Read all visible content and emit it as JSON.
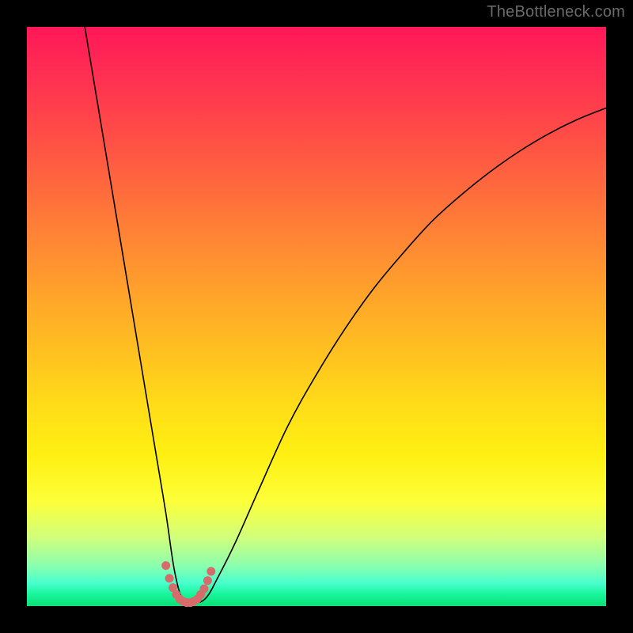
{
  "watermark": {
    "text": "TheBottleneck.com"
  },
  "plot": {
    "gradient_stops": [
      {
        "pct": 0,
        "color": "#ff1758"
      },
      {
        "pct": 8,
        "color": "#ff2e52"
      },
      {
        "pct": 18,
        "color": "#ff4b47"
      },
      {
        "pct": 28,
        "color": "#ff6a3d"
      },
      {
        "pct": 38,
        "color": "#ff8a33"
      },
      {
        "pct": 48,
        "color": "#ffa928"
      },
      {
        "pct": 58,
        "color": "#ffc61e"
      },
      {
        "pct": 66,
        "color": "#ffde18"
      },
      {
        "pct": 74,
        "color": "#fff012"
      },
      {
        "pct": 82,
        "color": "#fcff3a"
      },
      {
        "pct": 88,
        "color": "#d2ff7a"
      },
      {
        "pct": 93,
        "color": "#8cffae"
      },
      {
        "pct": 96,
        "color": "#48ffcd"
      },
      {
        "pct": 98,
        "color": "#17f59a"
      },
      {
        "pct": 100,
        "color": "#0ddf74"
      }
    ]
  },
  "chart_data": {
    "type": "line",
    "title": "",
    "xlabel": "",
    "ylabel": "",
    "xlim": [
      0,
      100
    ],
    "ylim": [
      0,
      100
    ],
    "series": [
      {
        "name": "bottleneck-curve",
        "x": [
          10,
          12,
          14,
          16,
          18,
          20,
          22,
          24,
          25.5,
          27,
          29,
          31,
          33,
          36,
          40,
          45,
          50,
          55,
          60,
          65,
          70,
          75,
          80,
          85,
          90,
          95,
          100
        ],
        "y": [
          100,
          88,
          76,
          64,
          52,
          40,
          28,
          16,
          6,
          1,
          0.5,
          1.5,
          5,
          11,
          20,
          31,
          40,
          48,
          55,
          61,
          66.5,
          71,
          75,
          78.5,
          81.5,
          84,
          86
        ]
      }
    ],
    "highlight_points": {
      "name": "bottom-cluster",
      "color": "#d76b6b",
      "x": [
        24.0,
        24.6,
        25.2,
        25.8,
        26.4,
        27.0,
        27.6,
        28.2,
        28.8,
        29.4,
        30.0,
        30.6,
        31.2,
        31.8
      ],
      "y": [
        7.0,
        4.8,
        3.2,
        2.0,
        1.2,
        0.8,
        0.6,
        0.6,
        0.8,
        1.2,
        2.0,
        3.0,
        4.4,
        6.0
      ]
    }
  }
}
